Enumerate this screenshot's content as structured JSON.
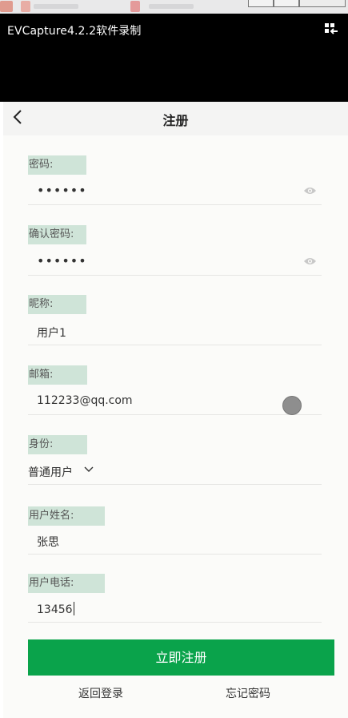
{
  "capture_window": {
    "title": "EVCapture4.2.2软件录制"
  },
  "navbar": {
    "title": "注册"
  },
  "form": {
    "password": {
      "label": "密码:",
      "value": "••••••"
    },
    "confirm_password": {
      "label": "确认密码:",
      "value": "••••••"
    },
    "nickname": {
      "label": "昵称:",
      "value": "用户1"
    },
    "email": {
      "label": "邮箱:",
      "value": "112233@qq.com"
    },
    "role": {
      "label": "身份:",
      "value": "普通用户"
    },
    "real_name": {
      "label": "用户姓名:",
      "value": "张思"
    },
    "phone": {
      "label": "用户电话:",
      "value": "13456"
    }
  },
  "actions": {
    "submit_label": "立即注册",
    "back_to_login": "返回登录",
    "forgot_password": "忘记密码"
  },
  "colors": {
    "accent": "#0aa34b",
    "label_highlight": "#cfe4d8"
  }
}
